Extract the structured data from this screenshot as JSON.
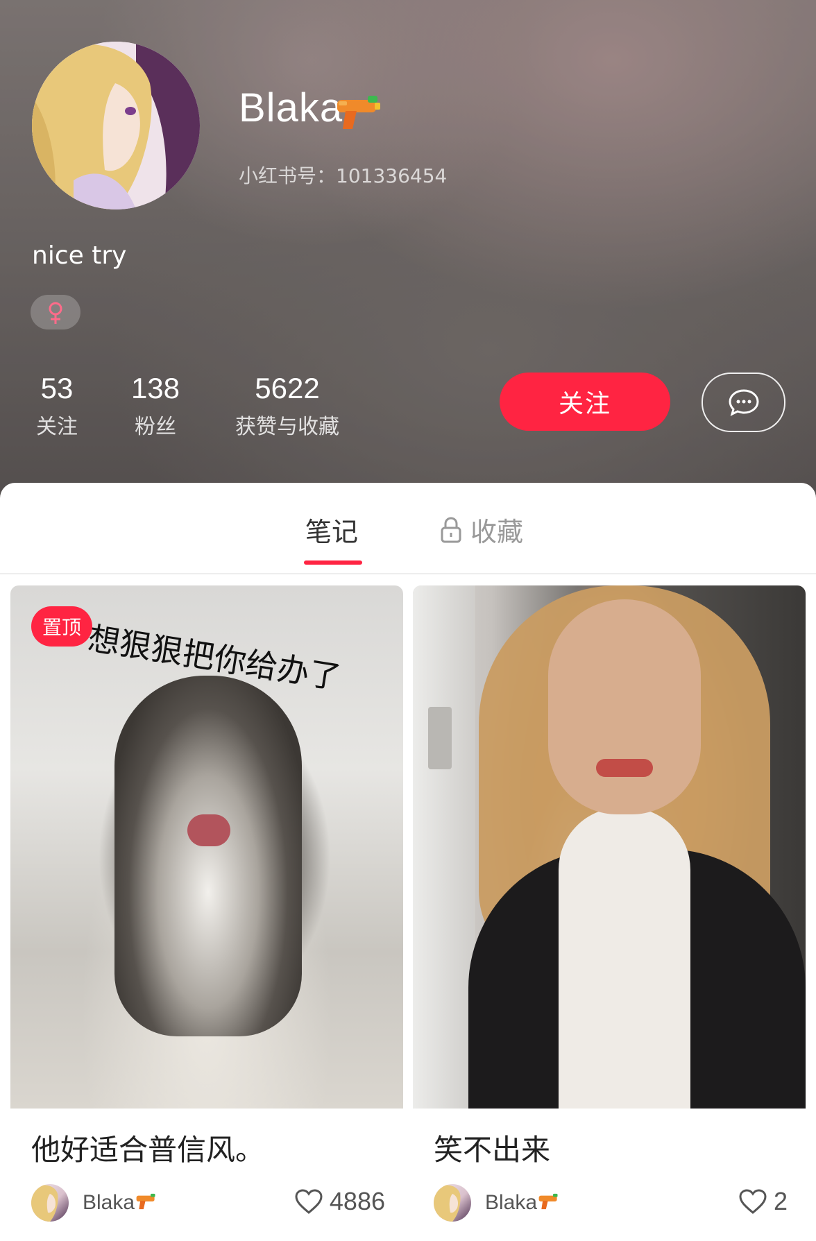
{
  "profile": {
    "name": "Blaka",
    "redbook_id": "小红书号：101336454",
    "bio": "nice try",
    "gender_symbol": "♀",
    "stats": [
      {
        "value": "53",
        "label": "关注"
      },
      {
        "value": "138",
        "label": "粉丝"
      },
      {
        "value": "5622",
        "label": "获赞与收藏"
      }
    ],
    "follow_label": "关注"
  },
  "tabs": {
    "notes": "笔记",
    "favorites": "收藏"
  },
  "notes": [
    {
      "pinned_label": "置顶",
      "overlay_text": "想狠狠把你给办了",
      "title": "他好适合普信风。",
      "author": "Blaka",
      "likes": "4886"
    },
    {
      "title": "笑不出来",
      "author": "Blaka",
      "likes": "2"
    }
  ],
  "colors": {
    "accent": "#ff2442"
  },
  "icons": [
    "water-gun-icon",
    "female-icon",
    "message-icon",
    "lock-icon",
    "heart-icon"
  ]
}
